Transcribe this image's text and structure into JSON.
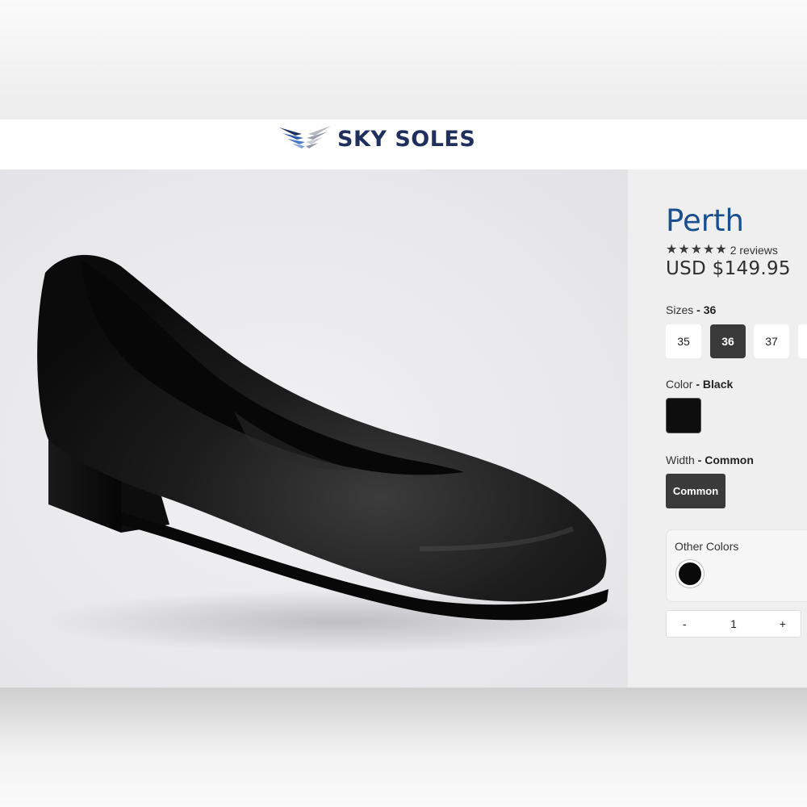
{
  "brand": {
    "name": "SKY SOLES"
  },
  "product": {
    "title": "Perth",
    "rating": {
      "stars": 5,
      "reviews_text": "2 reviews"
    },
    "price": "USD $149.95",
    "image_alt": "black leather flat shoe",
    "sizes": {
      "label": "Sizes",
      "selected_prefix": " - ",
      "selected": "36",
      "options": [
        "35",
        "36",
        "37"
      ]
    },
    "color": {
      "label": "Color",
      "selected_prefix": " - ",
      "selected": "Black",
      "swatch_hex": "#0e0e0e"
    },
    "width": {
      "label": "Width",
      "selected_prefix": " - ",
      "selected": "Common",
      "option": "Common"
    },
    "other_colors": {
      "label": "Other Colors",
      "swatch_hex": "#0a0a0a"
    },
    "quantity": {
      "minus": "-",
      "value": "1",
      "plus": "+"
    }
  },
  "colors": {
    "title": "#1a4f8f",
    "logo": "#1f2f5e",
    "selected_button": "#3a3a3a"
  }
}
